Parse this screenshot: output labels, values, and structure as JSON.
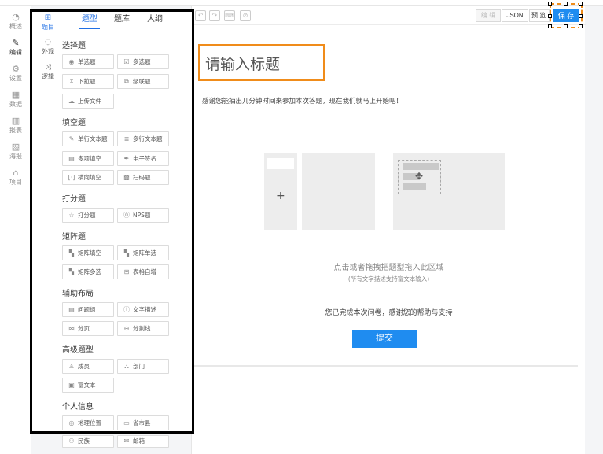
{
  "rail": [
    {
      "label": "概述",
      "icon": "gauge-icon"
    },
    {
      "label": "编辑",
      "icon": "pencil-icon",
      "active": true
    },
    {
      "label": "设置",
      "icon": "gear-icon"
    },
    {
      "label": "数据",
      "icon": "table-icon"
    },
    {
      "label": "报表",
      "icon": "bar-chart-icon"
    },
    {
      "label": "海报",
      "icon": "image-icon"
    },
    {
      "label": "项目",
      "icon": "home-icon"
    }
  ],
  "subnav": [
    {
      "label": "题目",
      "icon": "grid-icon",
      "active": true
    },
    {
      "label": "外观",
      "icon": "palette-icon"
    },
    {
      "label": "逻辑",
      "icon": "shuffle-icon"
    }
  ],
  "tabs": [
    "题型",
    "题库",
    "大纲"
  ],
  "groups": [
    {
      "title": "选择题",
      "items": [
        {
          "label": "单选题",
          "icon": "radio-icon"
        },
        {
          "label": "多选题",
          "icon": "checkbox-icon"
        },
        {
          "label": "下拉题",
          "icon": "dropdown-icon"
        },
        {
          "label": "级联题",
          "icon": "cascade-icon"
        },
        {
          "label": "上传文件",
          "icon": "upload-icon"
        }
      ]
    },
    {
      "title": "填空题",
      "items": [
        {
          "label": "单行文本题",
          "icon": "edit-icon"
        },
        {
          "label": "多行文本题",
          "icon": "multiline-icon"
        },
        {
          "label": "多项填空",
          "icon": "multi-fill-icon"
        },
        {
          "label": "电子签名",
          "icon": "signature-icon"
        },
        {
          "label": "横向填空",
          "icon": "bracket-icon"
        },
        {
          "label": "扫码题",
          "icon": "qrcode-icon"
        }
      ]
    },
    {
      "title": "打分题",
      "items": [
        {
          "label": "打分题",
          "icon": "star-icon"
        },
        {
          "label": "NPS题",
          "icon": "nps-icon"
        }
      ]
    },
    {
      "title": "矩阵题",
      "items": [
        {
          "label": "矩阵填空",
          "icon": "matrix-icon"
        },
        {
          "label": "矩阵单选",
          "icon": "matrix-icon"
        },
        {
          "label": "矩阵多选",
          "icon": "matrix-icon"
        },
        {
          "label": "表格自增",
          "icon": "table-add-icon"
        }
      ]
    },
    {
      "title": "辅助布局",
      "items": [
        {
          "label": "问题组",
          "icon": "group-icon"
        },
        {
          "label": "文字描述",
          "icon": "info-icon"
        },
        {
          "label": "分页",
          "icon": "page-break-icon"
        },
        {
          "label": "分割线",
          "icon": "divider-icon"
        }
      ]
    },
    {
      "title": "高级题型",
      "items": [
        {
          "label": "成员",
          "icon": "person-icon"
        },
        {
          "label": "部门",
          "icon": "org-icon"
        },
        {
          "label": "富文本",
          "icon": "rich-text-icon"
        }
      ]
    },
    {
      "title": "个人信息",
      "items": [
        {
          "label": "地理位置",
          "icon": "location-icon"
        },
        {
          "label": "省市县",
          "icon": "card-icon"
        },
        {
          "label": "民族",
          "icon": "people-icon"
        },
        {
          "label": "邮箱",
          "icon": "mail-icon"
        }
      ]
    }
  ],
  "toolbar": {
    "icons": [
      "undo-icon",
      "redo-icon",
      "keyboard-icon",
      "clear-format-icon"
    ],
    "edit_label": "编 辑",
    "json_label": "JSON",
    "preview_label": "预 览",
    "save_label": "保 存"
  },
  "survey": {
    "title": "请输入标题",
    "intro": "感谢您能抽出几分钟时间来参加本次答题，现在我们就马上开始吧！",
    "drop_hint": "点击或者拖拽把题型拖入此区域",
    "drop_sub": "(所有文字描述支持富文本输入)",
    "thanks": "您已完成本次问卷，感谢您的帮助与支持",
    "submit_label": "提交"
  },
  "colors": {
    "accent": "#1f8cf0",
    "highlight": "#f08c1a",
    "outline": "#000000"
  }
}
